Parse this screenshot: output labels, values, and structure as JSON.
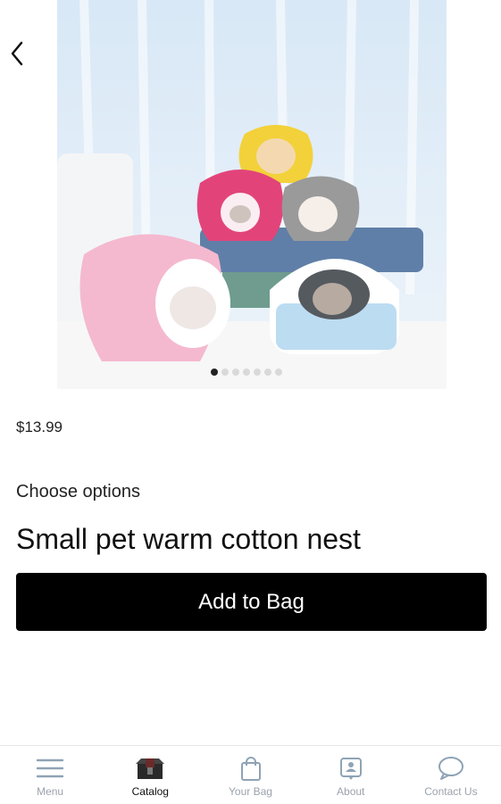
{
  "product": {
    "price": "$13.99",
    "choose_options": "Choose options",
    "title": "Small pet warm cotton nest",
    "add_to_bag": "Add to Bag"
  },
  "carousel": {
    "total": 7,
    "current": 1
  },
  "tabs": [
    {
      "label": "Menu",
      "icon": "menu-icon",
      "active": false
    },
    {
      "label": "Catalog",
      "icon": "catalog-icon",
      "active": true
    },
    {
      "label": "Your Bag",
      "icon": "bag-icon",
      "active": false
    },
    {
      "label": "About",
      "icon": "about-icon",
      "active": false
    },
    {
      "label": "Contact Us",
      "icon": "chat-icon",
      "active": false
    }
  ]
}
